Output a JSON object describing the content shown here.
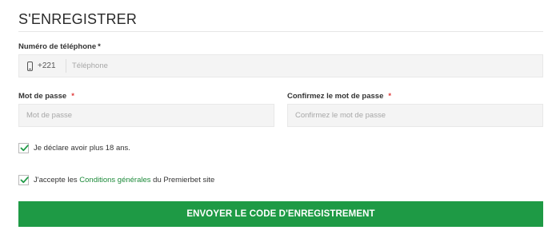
{
  "form": {
    "title": "S'ENREGISTRER",
    "phone": {
      "label": "Numéro de téléphone",
      "required_mark": "*",
      "icon": "phone-icon",
      "prefix": "+221",
      "placeholder": "Téléphone",
      "value": ""
    },
    "password": {
      "label": "Mot de passe",
      "required_mark": "*",
      "placeholder": "Mot de passe",
      "value": ""
    },
    "confirm_password": {
      "label": "Confirmez le mot de passe",
      "required_mark": "*",
      "placeholder": "Confirmez le mot de passe",
      "value": ""
    },
    "age_checkbox": {
      "checked": true,
      "label": "Je déclare avoir plus 18 ans."
    },
    "terms_checkbox": {
      "checked": true,
      "label_before": "J'accepte les",
      "link_text": "Conditions générales",
      "label_after": "du Premierbet site"
    },
    "submit_label": "ENVOYER LE CODE D'ENREGISTREMENT"
  },
  "colors": {
    "accent_green": "#1e9a45",
    "link_green": "#1d8a3a",
    "required_red": "#e03a3a",
    "field_bg": "#f4f4f4"
  }
}
